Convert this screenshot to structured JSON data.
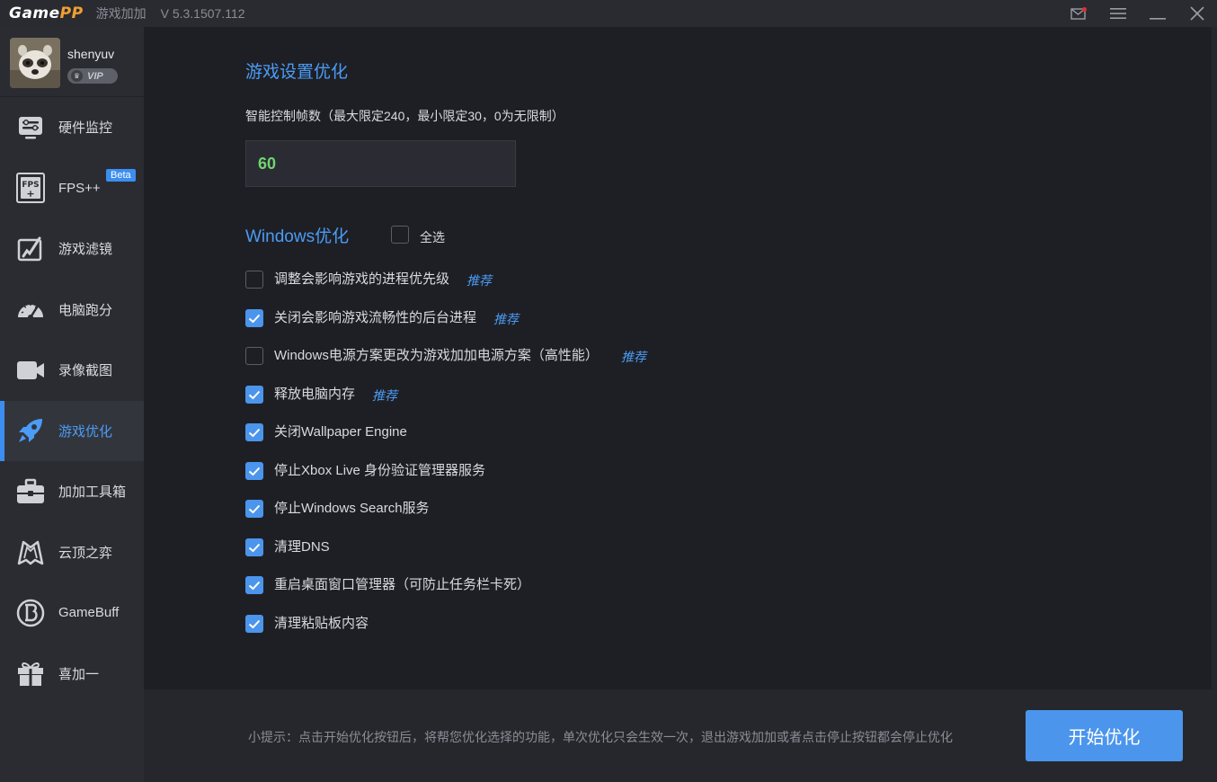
{
  "titlebar": {
    "logo_main": "Game",
    "logo_accent": "PP",
    "app_name": "游戏加加",
    "version": "V 5.3.1507.112",
    "icons": [
      "mail-icon",
      "menu-icon",
      "minimize-icon",
      "close-icon"
    ],
    "mail_badge_color": "#e03030"
  },
  "user": {
    "name": "shenyuv",
    "vip_label": "VIP"
  },
  "sidebar": {
    "items": [
      {
        "label": "硬件监控",
        "icon": "hardware-monitor-icon"
      },
      {
        "label": "FPS++",
        "icon": "fps-icon",
        "badge": "Beta"
      },
      {
        "label": "游戏滤镜",
        "icon": "game-filter-icon"
      },
      {
        "label": "电脑跑分",
        "icon": "speedometer-icon"
      },
      {
        "label": "录像截图",
        "icon": "video-camera-icon"
      },
      {
        "label": "游戏优化",
        "icon": "rocket-icon",
        "active": true
      },
      {
        "label": "加加工具箱",
        "icon": "toolbox-icon"
      },
      {
        "label": "云顶之弈",
        "icon": "tft-icon"
      },
      {
        "label": "GameBuff",
        "icon": "gamebuff-icon"
      },
      {
        "label": "喜加一",
        "icon": "gift-icon"
      }
    ]
  },
  "main": {
    "game_settings_title": "游戏设置优化",
    "fps_description": "智能控制帧数（最大限定240，最小限定30，0为无限制）",
    "fps_value": "60",
    "windows_title": "Windows优化",
    "select_all_label": "全选",
    "select_all_checked": false,
    "recommend_label": "推荐",
    "options": [
      {
        "label": "调整会影响游戏的进程优先级",
        "checked": false,
        "recommended": true
      },
      {
        "label": "关闭会影响游戏流畅性的后台进程",
        "checked": true,
        "recommended": true
      },
      {
        "label": "Windows电源方案更改为游戏加加电源方案（高性能）",
        "checked": false,
        "recommended": true
      },
      {
        "label": "释放电脑内存",
        "checked": true,
        "recommended": true
      },
      {
        "label": "关闭Wallpaper Engine",
        "checked": true,
        "recommended": false
      },
      {
        "label": "停止Xbox Live 身份验证管理器服务",
        "checked": true,
        "recommended": false
      },
      {
        "label": "停止Windows Search服务",
        "checked": true,
        "recommended": false
      },
      {
        "label": "清理DNS",
        "checked": true,
        "recommended": false
      },
      {
        "label": "重启桌面窗口管理器（可防止任务栏卡死）",
        "checked": true,
        "recommended": false
      },
      {
        "label": "清理粘贴板内容",
        "checked": true,
        "recommended": false
      }
    ]
  },
  "footer": {
    "tip": "小提示：点击开始优化按钮后，将帮您优化选择的功能，单次优化只会生效一次，退出游戏加加或者点击停止按钮都会停止优化",
    "start_button": "开始优化"
  },
  "colors": {
    "accent": "#4b95ec",
    "fps_value": "#6fd66f",
    "logo_accent": "#f0a030"
  }
}
